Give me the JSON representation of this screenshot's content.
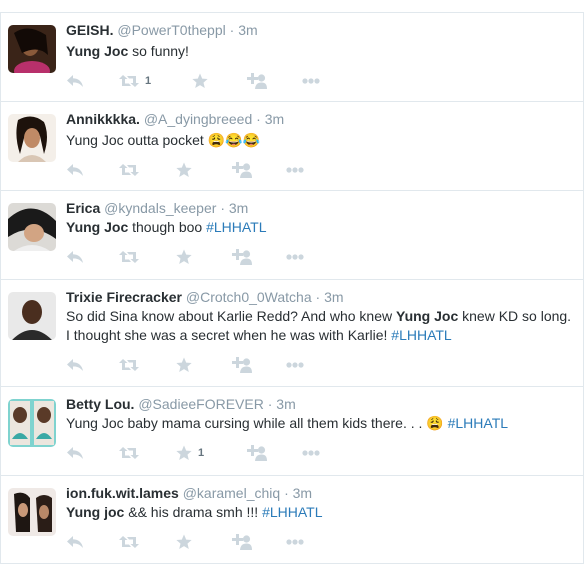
{
  "colors": {
    "icon": "#ccd6dd",
    "link": "#2b7bb9",
    "muted": "#8899a6",
    "text": "#292f33"
  },
  "tweets": [
    {
      "fullname": "GEISH.",
      "username": "@PowerT0theppl",
      "sep": "·",
      "time": "3m",
      "text": [
        {
          "t": "Yung Joc",
          "b": true
        },
        {
          "t": " so funny!"
        }
      ],
      "retweets": "1",
      "favorites": ""
    },
    {
      "fullname": "Annikkkka.",
      "username": "@A_dyingbreeed",
      "sep": "·",
      "time": "3m",
      "text": [
        {
          "t": "Yung Joc outta pocket "
        },
        {
          "t": "😩😂😂"
        }
      ],
      "retweets": "",
      "favorites": ""
    },
    {
      "fullname": "Erica",
      "username": "@kyndals_keeper",
      "sep": "·",
      "time": "3m",
      "text": [
        {
          "t": "Yung Joc",
          "b": true
        },
        {
          "t": " though boo "
        },
        {
          "t": "#LHHATL",
          "h": true
        }
      ],
      "retweets": "",
      "favorites": ""
    },
    {
      "fullname": "Trixie Firecracker",
      "username": "@Crotch0_0Watcha",
      "sep": "·",
      "time": "3m",
      "text": [
        {
          "t": "So did Sina know about Karlie Redd? And who knew "
        },
        {
          "t": "Yung Joc",
          "b": true
        },
        {
          "t": " knew KD so long. I thought she was a secret when he was with Karlie! "
        },
        {
          "t": "#LHHATL",
          "h": true
        }
      ],
      "retweets": "",
      "favorites": ""
    },
    {
      "fullname": "Betty Lou.",
      "username": "@SadieeFOREVER",
      "sep": "·",
      "time": "3m",
      "text": [
        {
          "t": "Yung Joc baby mama cursing while all them kids there. . . "
        },
        {
          "t": "😩"
        },
        {
          "t": " "
        },
        {
          "t": "#LHHATL",
          "h": true
        }
      ],
      "retweets": "",
      "favorites": "1"
    },
    {
      "fullname": "ion.fuk.wit.lames",
      "username": "@karamel_chiq",
      "sep": "·",
      "time": "3m",
      "text": [
        {
          "t": "Yung joc",
          "b": true
        },
        {
          "t": " && his drama smh !!! "
        },
        {
          "t": "#LHHATL",
          "h": true
        }
      ],
      "retweets": "",
      "favorites": ""
    }
  ]
}
